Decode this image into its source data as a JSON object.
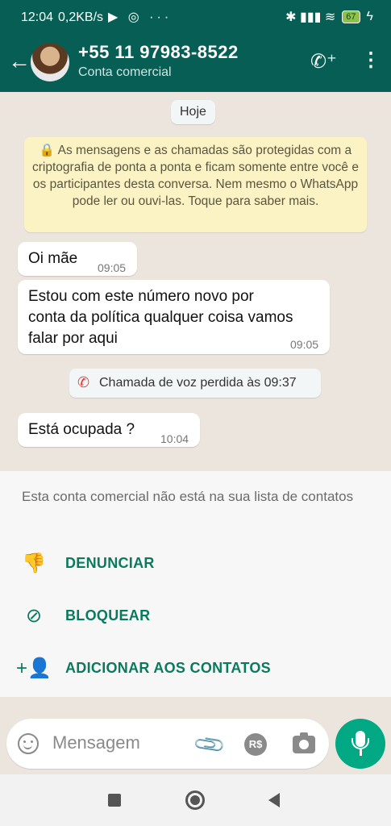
{
  "status_bar": {
    "time": "12:04",
    "speed": "0,2KB/s",
    "left_icons": "▶ ◎ ···",
    "right_icons": "✱ ▮▮▮ ≋",
    "battery": "67",
    "charging": "ϟ"
  },
  "header": {
    "back_icon": "←",
    "title": "+55 11 97983-8522",
    "subtitle": "Conta comercial",
    "call_icon": "✆⁺",
    "menu_icon": "⋮"
  },
  "chat": {
    "date_chip": "Hoje",
    "encryption_notice": "🔒 As mensagens e as chamadas são protegidas com a criptografia de ponta a ponta e ficam somente entre você e os participantes desta conversa. Nem mesmo o WhatsApp pode ler ou ouvi-las. Toque para saber mais.",
    "messages": [
      {
        "text": "Oi mãe",
        "time": "09:05"
      },
      {
        "text": "Estou com este número novo por conta da política qualquer coisa vamos falar por aqui",
        "time": "09:05"
      },
      {
        "text": "Está ocupada ?",
        "time": "10:04"
      }
    ],
    "missed_call": {
      "icon": "✆",
      "text": "Chamada de voz perdida às 09:37"
    }
  },
  "business_panel": {
    "info": "Esta conta comercial não está na sua lista de contatos",
    "actions": [
      {
        "icon": "👎",
        "label": "DENUNCIAR"
      },
      {
        "icon": "⊘",
        "label": "BLOQUEAR"
      },
      {
        "icon": "+👤",
        "label": "ADICIONAR AOS CONTATOS"
      }
    ]
  },
  "composer": {
    "placeholder": "Mensagem",
    "rs_label": "R$",
    "clip_icon": "📎"
  },
  "colors": {
    "header": "#075e54",
    "accent": "#00a884",
    "action_text": "#0a7a5c",
    "notice_bg": "#fcf3c4"
  }
}
